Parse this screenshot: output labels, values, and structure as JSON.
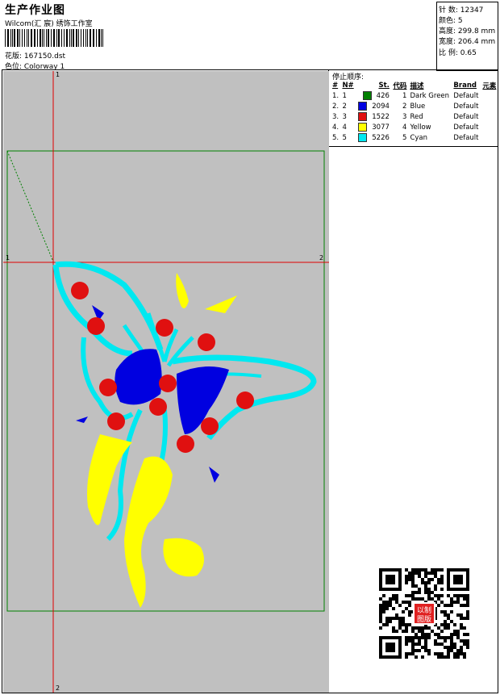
{
  "header": {
    "title": "生产作业图",
    "subtitle": "Wilcom(汇 宸) 绣饰工作室",
    "design_label": "花版: 167150.dst",
    "colorway_label": "色位: Colorway 1"
  },
  "stats": {
    "stitches": {
      "label": "针 数:",
      "value": "12347"
    },
    "colors": {
      "label": "颜色:",
      "value": "5"
    },
    "height": {
      "label": "高度:",
      "value": "299.8 mm"
    },
    "width": {
      "label": "宽度:",
      "value": "206.4 mm"
    },
    "scale": {
      "label": "比 例:",
      "value": "0.65"
    }
  },
  "stop_sequence": {
    "title": "停止顺序:",
    "headers": [
      "#",
      "N#",
      "St.",
      "代码",
      "描述",
      "Brand",
      "元素"
    ],
    "rows": [
      {
        "idx": "1.",
        "n": "1",
        "color": "#008000",
        "st": "426",
        "code": "1",
        "desc": "Dark Green",
        "brand": "Default"
      },
      {
        "idx": "2.",
        "n": "2",
        "color": "#0000e0",
        "st": "2094",
        "code": "2",
        "desc": "Blue",
        "brand": "Default"
      },
      {
        "idx": "3.",
        "n": "3",
        "color": "#e01010",
        "st": "1522",
        "code": "3",
        "desc": "Red",
        "brand": "Default"
      },
      {
        "idx": "4.",
        "n": "4",
        "color": "#ffff00",
        "st": "3077",
        "code": "4",
        "desc": "Yellow",
        "brand": "Default"
      },
      {
        "idx": "5.",
        "n": "5",
        "color": "#00e8f0",
        "st": "5226",
        "code": "5",
        "desc": "Cyan",
        "brand": "Default"
      }
    ]
  },
  "canvas": {
    "axis_labels": {
      "top": "1",
      "bottom": "2",
      "left": "1",
      "right": "2"
    },
    "background": "#c0c0c0"
  },
  "stamp": {
    "text_top": "以制",
    "text_bottom": "图版"
  }
}
